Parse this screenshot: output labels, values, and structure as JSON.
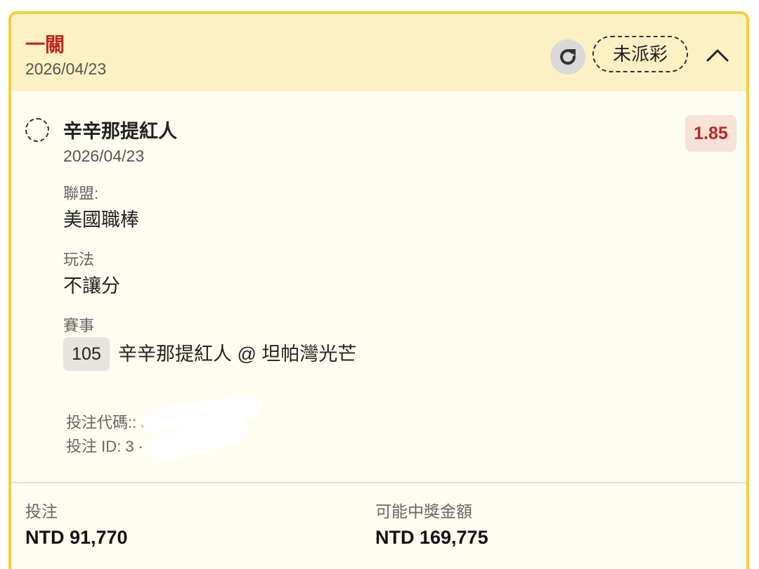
{
  "card": {
    "title": "一關",
    "date": "2026/04/23",
    "status": "未派彩"
  },
  "selection": {
    "team": "辛辛那提紅人",
    "date": "2026/04/23",
    "odds": "1.85",
    "league_label": "聯盟:",
    "league": "美國職棒",
    "play_label": "玩法",
    "play": "不讓分",
    "match_label": "賽事",
    "match_number": "105",
    "match": "辛辛那提紅人 @ 坦帕灣光芒"
  },
  "bet_codes": {
    "code_line": "投注代碼:: 3· · ·  ·4c",
    "id_line": "投注 ID: 3  ·  10  · .1"
  },
  "footer": {
    "stake_label": "投注",
    "stake_value": "NTD 91,770",
    "payout_label": "可能中獎金額",
    "payout_value": "NTD 169,775"
  },
  "colors": {
    "border": "#f4cf3d",
    "header_bg": "#fdf1c4",
    "title": "#c0281f",
    "odds_text": "#b8282a",
    "odds_bg": "#f8e2d5"
  },
  "icons": {
    "refresh": "refresh-icon",
    "collapse": "chevron-up-icon",
    "selection": "dashed-circle-icon"
  }
}
